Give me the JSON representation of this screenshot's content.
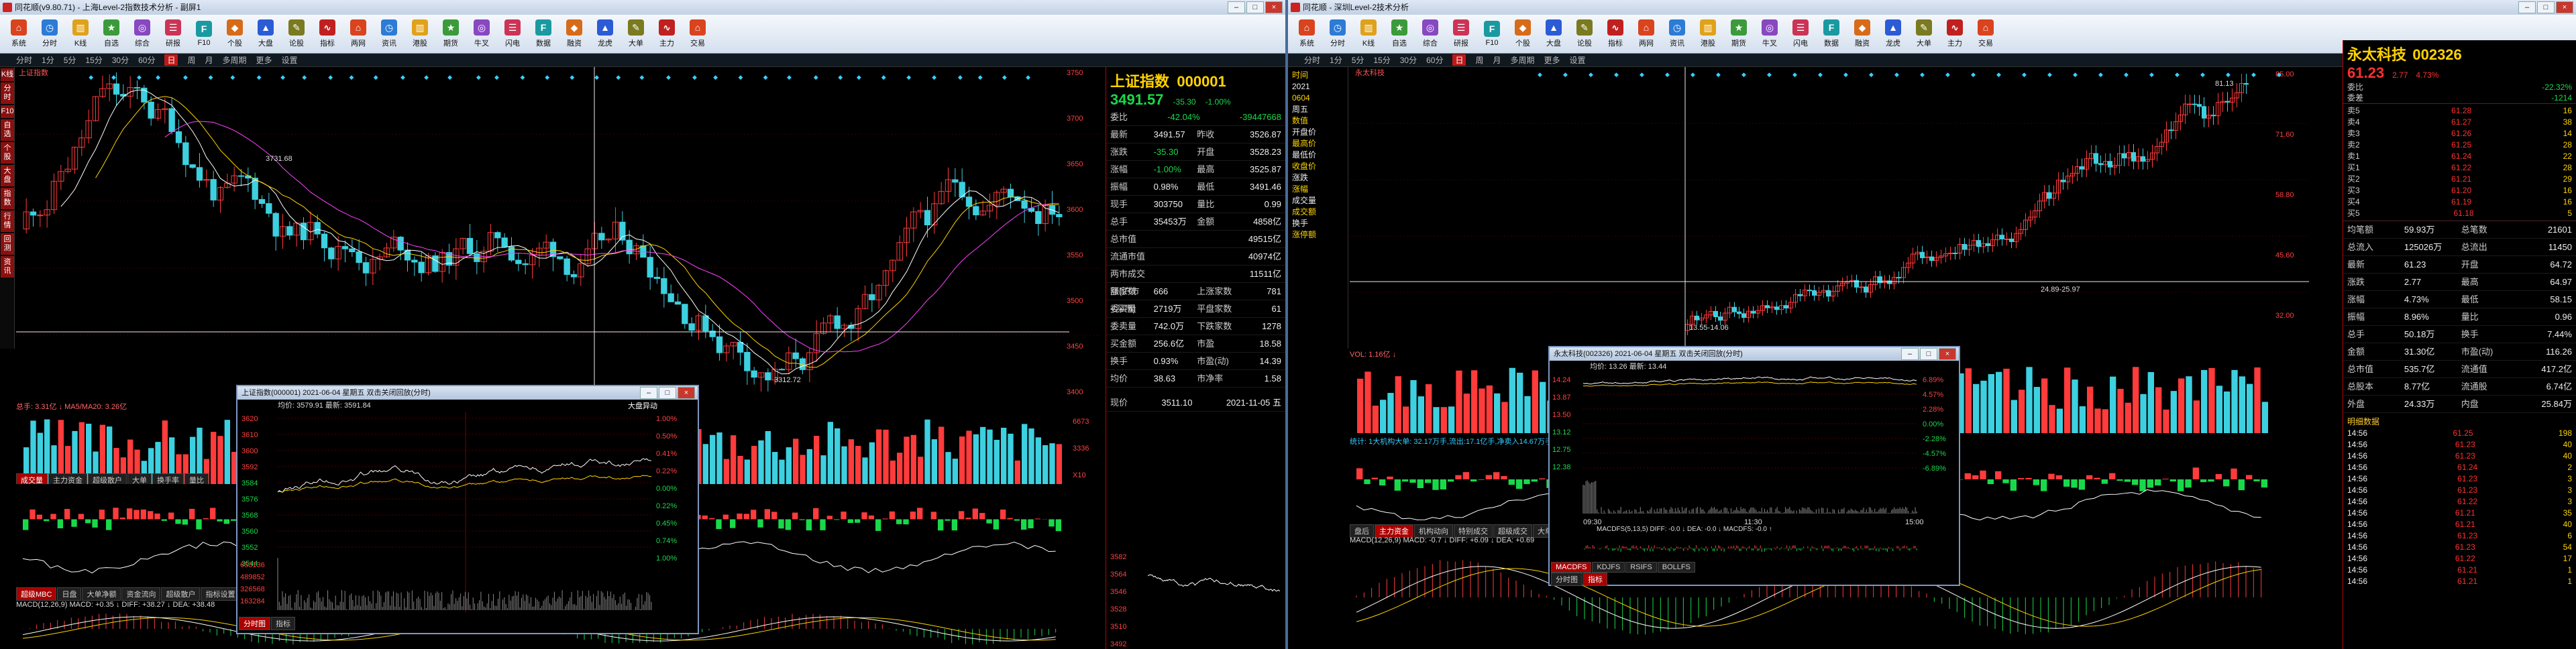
{
  "left": {
    "title": "同花顺(v9.80.71) - 上海Level-2指数技术分析 - 副屏1",
    "toolbar": [
      "系统",
      "分时",
      "K线",
      "自选",
      "综合",
      "研报",
      "F10",
      "个股",
      "大盘",
      "论股",
      "指标",
      "两网",
      "资讯",
      "港股",
      "期货",
      "牛叉",
      "闪电",
      "数据",
      "融资",
      "龙虎",
      "大单",
      "主力",
      "交易"
    ],
    "menu": [
      "分时",
      "1分",
      "5分",
      "15分",
      "30分",
      "60分",
      "日",
      "周",
      "月",
      "多周期",
      "更多",
      "设置"
    ],
    "menu_active": "日",
    "stock_label": "上证指数",
    "quote": {
      "name": "上证指数",
      "code": "000001",
      "price": "3491.57",
      "change": "-35.30",
      "pct": "-1.00%",
      "ratio_label": "委比",
      "ratio_value": "-42.04%",
      "ratio_extra": "-39447668",
      "rows": [
        [
          "最新",
          "3491.57",
          "昨收",
          "3526.87"
        ],
        [
          "涨跌",
          "-35.30",
          "开盘",
          "3528.23"
        ],
        [
          "涨幅",
          "-1.00%",
          "最高",
          "3525.87"
        ],
        [
          "振幅",
          "0.98%",
          "最低",
          "3491.46"
        ],
        [
          "现手",
          "303750",
          "量比",
          "0.99"
        ],
        [
          "总手",
          "35453万",
          "金额",
          "4858亿"
        ],
        [
          "总市值",
          "",
          "",
          "49515亿"
        ],
        [
          "流通市值",
          "",
          "",
          "40974亿"
        ],
        [
          "两市成交额(沪市+深市)",
          "",
          "",
          "11511亿"
        ],
        [
          "涨家数",
          "666",
          "上涨家数",
          "781"
        ],
        [
          "委买量",
          "2719万",
          "平盘家数",
          "61"
        ],
        [
          "委卖量",
          "742.0万",
          "下跌家数",
          "1278"
        ],
        [
          "买金额",
          "256.6亿",
          "市盈",
          "18.58"
        ],
        [
          "换手",
          "0.93%",
          "市盈(动)",
          "14.39"
        ],
        [
          "均价",
          "38.63",
          "市净率",
          "1.58"
        ]
      ],
      "time_label": "现价",
      "time_value": "3511.10",
      "date": "2021-11-05 五"
    },
    "price_scale": [
      "3750",
      "3700",
      "3650",
      "3600",
      "3550",
      "3500",
      "3450",
      "3400"
    ],
    "high_label": "3731.68",
    "low_label": "3312.72",
    "vol_label": "总手: 3.31亿 ↓ MA5/MA20: 3.26亿",
    "macd_label": "MACD(12,26,9) MACD: +0.35 ↓ DIFF: +38.27 ↓ DEA: +38.48",
    "ind_tabs": [
      "成交量",
      "主力资金",
      "超级散户",
      "大单",
      "换手率",
      "量比"
    ],
    "popup": {
      "title": "上证指数(000001) 2021-06-04 星期五    双击关闭回放(分时)",
      "info": "均价: 3579.91 最新: 3591.84",
      "chg_label": "大盘异动",
      "left_scale": [
        "3620",
        "3610",
        "3600",
        "3592",
        "3584",
        "3576",
        "3568",
        "3560",
        "3552",
        "3544"
      ],
      "right_scale": [
        "1.00%",
        "0.50%",
        "0.41%",
        "0.22%",
        "0.00%",
        "0.22%",
        "0.45%",
        "0.74%",
        "1.00%"
      ],
      "vol_scale": [
        "653136",
        "489852",
        "326568",
        "163284"
      ],
      "tabs": [
        "分时图",
        "指标"
      ]
    },
    "side_tabs": [
      "K线",
      "分时",
      "F10",
      "自选",
      "个股",
      "大盘",
      "指数",
      "行情",
      "回测",
      "资讯"
    ],
    "bottom_tabs": [
      "超级MBC",
      "日盘",
      "大单净额",
      "资金流向",
      "超级散户",
      "指标设置"
    ]
  },
  "right": {
    "title": "同花顺 - 深圳Level-2技术分析",
    "toolbar": [
      "系统",
      "分时",
      "K线",
      "自选",
      "综合",
      "研报",
      "F10",
      "个股",
      "大盘",
      "论股",
      "指标",
      "两网",
      "资讯",
      "港股",
      "期货",
      "牛叉",
      "闪电",
      "数据",
      "融资",
      "龙虎",
      "大单",
      "主力",
      "交易"
    ],
    "menu": [
      "分时",
      "1分",
      "5分",
      "15分",
      "30分",
      "60分",
      "日",
      "周",
      "月",
      "多周期",
      "更多",
      "设置"
    ],
    "menu_active": "日",
    "stock_label": "永太科技",
    "quote": {
      "name": "永太科技",
      "code": "002326",
      "price": "61.23",
      "change": "2.77",
      "pct": "4.73%",
      "wb_label": "委比",
      "wb": "-22.32%",
      "wc_label": "委差",
      "wc": "-1214",
      "sell": [
        [
          "5",
          "61.28",
          "16"
        ],
        [
          "4",
          "61.27",
          "38"
        ],
        [
          "3",
          "61.26",
          "14"
        ],
        [
          "2",
          "61.25",
          "28"
        ],
        [
          "1",
          "61.24",
          "22"
        ]
      ],
      "buy": [
        [
          "1",
          "61.22",
          "28"
        ],
        [
          "2",
          "61.21",
          "29"
        ],
        [
          "3",
          "61.20",
          "16"
        ],
        [
          "4",
          "61.19",
          "16"
        ],
        [
          "5",
          "61.18",
          "5"
        ]
      ],
      "rows": [
        [
          "均笔额",
          "59.93万",
          "总笔数",
          "21601"
        ],
        [
          "总流入",
          "125026万",
          "总流出",
          "11450"
        ],
        [
          "最新",
          "61.23",
          "开盘",
          "64.72"
        ],
        [
          "涨跌",
          "2.77",
          "最高",
          "64.97"
        ],
        [
          "涨幅",
          "4.73%",
          "最低",
          "58.15"
        ],
        [
          "振幅",
          "8.96%",
          "量比",
          "0.96"
        ],
        [
          "总手",
          "50.18万",
          "换手",
          "7.44%"
        ],
        [
          "金额",
          "31.30亿",
          "市盈(动)",
          "116.26"
        ],
        [
          "总市值",
          "535.7亿",
          "流通值",
          "417.2亿"
        ],
        [
          "总股本",
          "8.77亿",
          "流通股",
          "6.74亿"
        ],
        [
          "外盘",
          "24.33万",
          "内盘",
          "25.84万"
        ]
      ],
      "ticks": [
        [
          "14:56",
          "61.25",
          "198"
        ],
        [
          "14:56",
          "61.23",
          "40"
        ],
        [
          "14:56",
          "61.23",
          "40"
        ],
        [
          "14:56",
          "61.24",
          "2"
        ],
        [
          "14:56",
          "61.23",
          "3"
        ],
        [
          "14:56",
          "61.23",
          "3"
        ],
        [
          "14:56",
          "61.22",
          "3"
        ],
        [
          "14:56",
          "61.21",
          "35"
        ],
        [
          "14:56",
          "61.21",
          "40"
        ],
        [
          "14:56",
          "61.23",
          "6"
        ],
        [
          "14:56",
          "61.23",
          "54"
        ],
        [
          "14:56",
          "61.22",
          "17"
        ],
        [
          "14:56",
          "61.21",
          "1"
        ],
        [
          "14:56",
          "61.21",
          "1"
        ]
      ],
      "detail_tab": "明细数据"
    },
    "high_label": "81.13",
    "low_label": "24.89-25.97",
    "start_label": "13.55-14.06",
    "left_labels": [
      "时间",
      "2021",
      "0604",
      "周五",
      "数值",
      "开盘价",
      "最高价",
      "最低价",
      "收盘价",
      "涨跌",
      "涨幅",
      "成交量",
      "成交额",
      "换手",
      "涨停额"
    ],
    "price_scale": [
      "85.00",
      "71.60",
      "58.80",
      "45.60",
      "32.00"
    ],
    "vol_label": "VOL: 1.16亿 ↓",
    "macd_label": "MACD(12,26,9) MACD: -0.7 ↓ DIFF: +6.09 ↓ DEA: +0.69",
    "popup": {
      "title": "永太科技(002326) 2021-06-04 星期五    双击关闭回放(分时)",
      "info": "均价: 13.26 最新: 13.44",
      "left_scale": [
        "14.24",
        "13.87",
        "13.50",
        "13.12",
        "12.75",
        "12.38"
      ],
      "right_scale": [
        "6.89%",
        "4.57%",
        "2.28%",
        "0.00%",
        "-2.28%",
        "-4.57%",
        "-6.89%"
      ],
      "macd_info": "MACDFS(5,13,5) DIFF: -0.0 ↓ DEA: -0.0 ↓ MACDFS: -0.0 ↑",
      "time_ticks": [
        "09:30",
        "11:30",
        "15:00"
      ],
      "tabs": [
        "MACDFS",
        "KDJFS",
        "RSIFS",
        "BOLLFS"
      ],
      "bottom_tabs": [
        "分时图",
        "指标"
      ]
    },
    "ind_tabs": [
      "盘后",
      "主力资金",
      "机构动向",
      "特别成交",
      "超级成交",
      "大单净量",
      "资金流向"
    ],
    "info_line": "统计: 1大机构大单: 32.17万手,流出:17.1亿手,净卖入14.67万手,占流通3.7%"
  }
}
